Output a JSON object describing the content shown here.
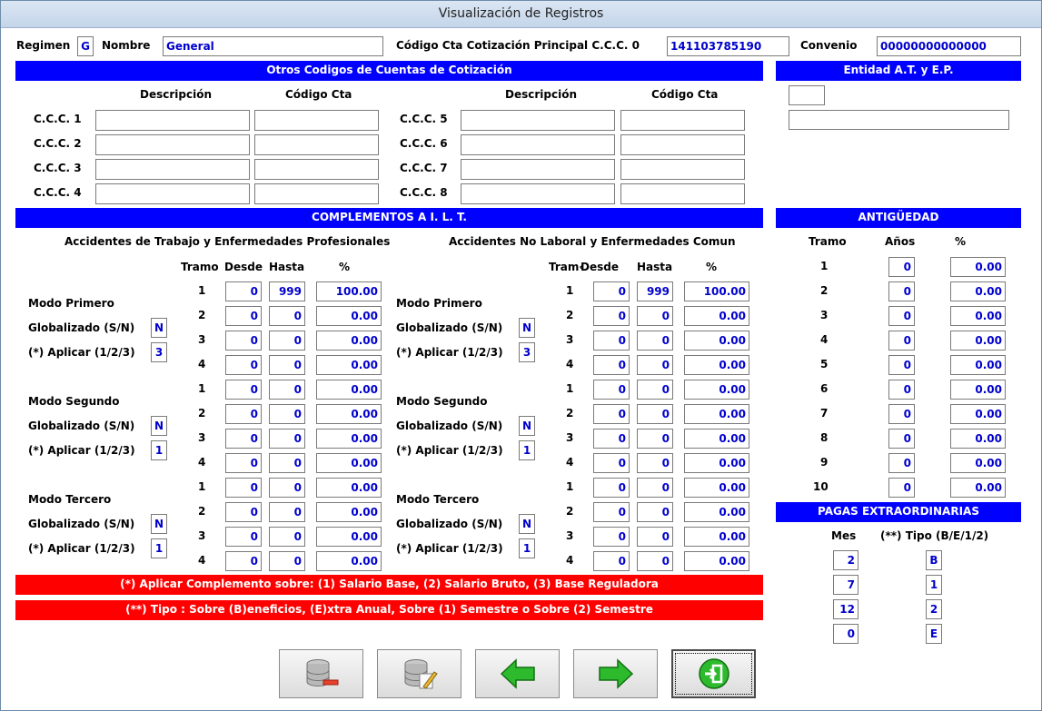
{
  "window": {
    "title": "Visualización de Registros"
  },
  "header": {
    "regimen_label": "Regimen",
    "regimen_value": "G",
    "nombre_label": "Nombre",
    "nombre_value": "General",
    "ccc_principal_label": "Código Cta Cotización Principal  C.C.C. 0",
    "ccc_principal_value": "141103785190",
    "convenio_label": "Convenio",
    "convenio_value": "00000000000000"
  },
  "otros_codigos": {
    "title": "Otros Codigos de Cuentas de Cotización",
    "descripcion_label": "Descripción",
    "codigo_cta_label": "Código Cta",
    "rows": [
      {
        "label": "C.C.C. 1",
        "descripcion": "",
        "codigo": ""
      },
      {
        "label": "C.C.C. 2",
        "descripcion": "",
        "codigo": ""
      },
      {
        "label": "C.C.C. 3",
        "descripcion": "",
        "codigo": ""
      },
      {
        "label": "C.C.C. 4",
        "descripcion": "",
        "codigo": ""
      },
      {
        "label": "C.C.C. 5",
        "descripcion": "",
        "codigo": ""
      },
      {
        "label": "C.C.C. 6",
        "descripcion": "",
        "codigo": ""
      },
      {
        "label": "C.C.C. 7",
        "descripcion": "",
        "codigo": ""
      },
      {
        "label": "C.C.C. 8",
        "descripcion": "",
        "codigo": ""
      }
    ]
  },
  "entidad": {
    "title": "Entidad A.T. y E.P.",
    "code": "",
    "name": ""
  },
  "complementos": {
    "title": "COMPLEMENTOS A I. L. T.",
    "col_tramo": "Tramo",
    "col_tramo_cut": "Tram‹",
    "col_desde": "Desde",
    "col_hasta": "Hasta",
    "col_pct": "%",
    "globalizado_label": "Globalizado (S/N)",
    "aplicar_label": "(*) Aplicar (1/2/3)",
    "at_ep": {
      "title": "Accidentes de Trabajo y Enfermedades Profesionales",
      "modos": [
        {
          "label": "Modo Primero",
          "globalizado": "N",
          "aplicar": "3",
          "rows": [
            {
              "tramo": "1",
              "desde": "0",
              "hasta": "999",
              "pct": "100.00"
            },
            {
              "tramo": "2",
              "desde": "0",
              "hasta": "0",
              "pct": "0.00"
            },
            {
              "tramo": "3",
              "desde": "0",
              "hasta": "0",
              "pct": "0.00"
            },
            {
              "tramo": "4",
              "desde": "0",
              "hasta": "0",
              "pct": "0.00"
            }
          ]
        },
        {
          "label": "Modo Segundo",
          "globalizado": "N",
          "aplicar": "1",
          "rows": [
            {
              "tramo": "1",
              "desde": "0",
              "hasta": "0",
              "pct": "0.00"
            },
            {
              "tramo": "2",
              "desde": "0",
              "hasta": "0",
              "pct": "0.00"
            },
            {
              "tramo": "3",
              "desde": "0",
              "hasta": "0",
              "pct": "0.00"
            },
            {
              "tramo": "4",
              "desde": "0",
              "hasta": "0",
              "pct": "0.00"
            }
          ]
        },
        {
          "label": "Modo Tercero",
          "globalizado": "N",
          "aplicar": "1",
          "rows": [
            {
              "tramo": "1",
              "desde": "0",
              "hasta": "0",
              "pct": "0.00"
            },
            {
              "tramo": "2",
              "desde": "0",
              "hasta": "0",
              "pct": "0.00"
            },
            {
              "tramo": "3",
              "desde": "0",
              "hasta": "0",
              "pct": "0.00"
            },
            {
              "tramo": "4",
              "desde": "0",
              "hasta": "0",
              "pct": "0.00"
            }
          ]
        }
      ]
    },
    "no_laboral": {
      "title": "Accidentes No Laboral y Enfermedades Comun",
      "modos": [
        {
          "label": "Modo Primero",
          "globalizado": "N",
          "aplicar": "3",
          "rows": [
            {
              "tramo": "1",
              "desde": "0",
              "hasta": "999",
              "pct": "100.00"
            },
            {
              "tramo": "2",
              "desde": "0",
              "hasta": "0",
              "pct": "0.00"
            },
            {
              "tramo": "3",
              "desde": "0",
              "hasta": "0",
              "pct": "0.00"
            },
            {
              "tramo": "4",
              "desde": "0",
              "hasta": "0",
              "pct": "0.00"
            }
          ]
        },
        {
          "label": "Modo Segundo",
          "globalizado": "N",
          "aplicar": "1",
          "rows": [
            {
              "tramo": "1",
              "desde": "0",
              "hasta": "0",
              "pct": "0.00"
            },
            {
              "tramo": "2",
              "desde": "0",
              "hasta": "0",
              "pct": "0.00"
            },
            {
              "tramo": "3",
              "desde": "0",
              "hasta": "0",
              "pct": "0.00"
            },
            {
              "tramo": "4",
              "desde": "0",
              "hasta": "0",
              "pct": "0.00"
            }
          ]
        },
        {
          "label": "Modo Tercero",
          "globalizado": "N",
          "aplicar": "1",
          "rows": [
            {
              "tramo": "1",
              "desde": "0",
              "hasta": "0",
              "pct": "0.00"
            },
            {
              "tramo": "2",
              "desde": "0",
              "hasta": "0",
              "pct": "0.00"
            },
            {
              "tramo": "3",
              "desde": "0",
              "hasta": "0",
              "pct": "0.00"
            },
            {
              "tramo": "4",
              "desde": "0",
              "hasta": "0",
              "pct": "0.00"
            }
          ]
        }
      ]
    }
  },
  "antiguedad": {
    "title": "ANTIGÜEDAD",
    "col_tramo": "Tramo",
    "col_anos": "Años",
    "col_pct": "%",
    "rows": [
      {
        "tramo": "1",
        "anos": "0",
        "pct": "0.00"
      },
      {
        "tramo": "2",
        "anos": "0",
        "pct": "0.00"
      },
      {
        "tramo": "3",
        "anos": "0",
        "pct": "0.00"
      },
      {
        "tramo": "4",
        "anos": "0",
        "pct": "0.00"
      },
      {
        "tramo": "5",
        "anos": "0",
        "pct": "0.00"
      },
      {
        "tramo": "6",
        "anos": "0",
        "pct": "0.00"
      },
      {
        "tramo": "7",
        "anos": "0",
        "pct": "0.00"
      },
      {
        "tramo": "8",
        "anos": "0",
        "pct": "0.00"
      },
      {
        "tramo": "9",
        "anos": "0",
        "pct": "0.00"
      },
      {
        "tramo": "10",
        "anos": "0",
        "pct": "0.00"
      }
    ]
  },
  "pagas": {
    "title": "PAGAS EXTRAORDINARIAS",
    "col_mes": "Mes",
    "col_tipo": "(**) Tipo (B/E/1/2)",
    "rows": [
      {
        "mes": "2",
        "tipo": "B"
      },
      {
        "mes": "7",
        "tipo": "1"
      },
      {
        "mes": "12",
        "tipo": "2"
      },
      {
        "mes": "0",
        "tipo": "E"
      }
    ]
  },
  "notes": {
    "aplicar": "(*) Aplicar Complemento sobre: (1) Salario Base, (2) Salario Bruto, (3) Base Reguladora",
    "tipo": "(**) Tipo : Sobre (B)eneficios, (E)xtra Anual, Sobre (1) Semestre o Sobre (2) Semestre"
  },
  "colors": {
    "section_blue": "#0000ff",
    "note_red": "#ff0000",
    "value_blue": "#0000cc"
  },
  "toolbar": {
    "buttons": [
      {
        "name": "delete-record-button",
        "icon": "database-minus-icon"
      },
      {
        "name": "edit-record-button",
        "icon": "database-edit-icon"
      },
      {
        "name": "previous-record-button",
        "icon": "arrow-left-icon"
      },
      {
        "name": "next-record-button",
        "icon": "arrow-right-icon"
      },
      {
        "name": "exit-button",
        "icon": "exit-icon"
      }
    ]
  }
}
